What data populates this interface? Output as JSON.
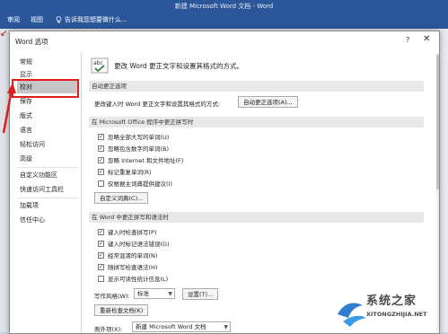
{
  "word": {
    "title": "新建 Microsoft Word 文档 - Word",
    "tabs": [
      "审阅",
      "视图"
    ],
    "search_hint": "告诉我您想要做什么..."
  },
  "dialog": {
    "title": "Word 选项",
    "help": "?",
    "close": "✕"
  },
  "nav": {
    "items": [
      "常规",
      "显示",
      "校对",
      "保存",
      "版式",
      "语言",
      "轻松访问",
      "高级",
      "自定义功能区",
      "快速访问工具栏",
      "加载项",
      "信任中心"
    ],
    "selected_index": 2
  },
  "content": {
    "heading": "更改 Word 更正文字和设置其格式的方式。",
    "autocorrect": {
      "section": "自动更正选项",
      "desc": "更改键入时 Word 更正文字和设置其格式的方式:",
      "button": "自动更正选项(A)..."
    },
    "office": {
      "section": "在 Microsoft Office 程序中更正拼写时",
      "options": [
        {
          "label": "忽略全部大写的单词(U)",
          "checked": true
        },
        {
          "label": "忽略包含数字的单词(B)",
          "checked": true
        },
        {
          "label": "忽略 Internet 和文件地址(F)",
          "checked": true
        },
        {
          "label": "标记重复单词(R)",
          "checked": true
        },
        {
          "label": "仅根据主词典提供建议(I)",
          "checked": false
        }
      ],
      "button": "自定义词典(C)..."
    },
    "word": {
      "section": "在 Word 中更正拼写和语法时",
      "options": [
        {
          "label": "键入时检查拼写(P)",
          "checked": true
        },
        {
          "label": "键入时标记语法错误(G)",
          "checked": true
        },
        {
          "label": "经常混淆的单词(N)",
          "checked": true
        },
        {
          "label": "随拼写检查语法(H)",
          "checked": true
        },
        {
          "label": "显示可读性统计信息(L)",
          "checked": false
        }
      ],
      "style_label": "写作风格(W):",
      "style_value": "标准",
      "settings_button": "设置(T)...",
      "recheck_button": "重新检查文档(K)"
    },
    "exceptions": {
      "label": "例外项(X):",
      "value": "新建 Microsoft Word 文档"
    }
  },
  "watermark": {
    "text": "系统之家",
    "url": "XITONGZHIJIA.NET"
  }
}
